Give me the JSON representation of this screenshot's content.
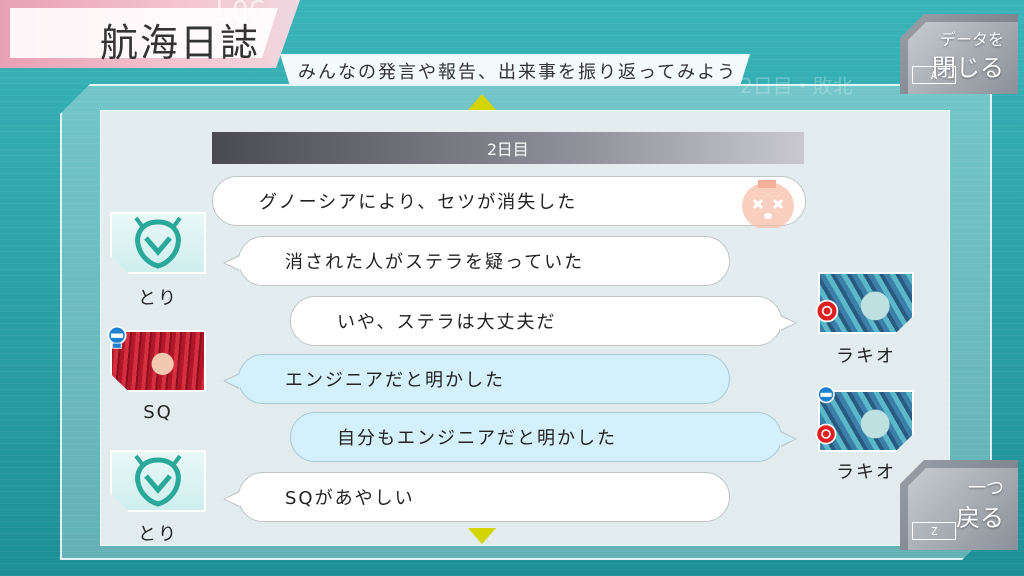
{
  "header": {
    "title": "航海日誌",
    "log_label": "LOG",
    "subtitle": "みんなの発言や報告、出来事を振り返ってみよう"
  },
  "buttons": {
    "close": {
      "line1": "データを",
      "line2": "閉じる",
      "key": "A"
    },
    "back": {
      "line1": "一つ",
      "line2": "戻る",
      "key": "Z"
    }
  },
  "day": {
    "label": "2日目"
  },
  "entries": [
    {
      "type": "event",
      "text": "グノーシアにより、セツが消失した"
    },
    {
      "speaker": "とり",
      "text": "消された人がステラを疑っていた",
      "side": "left"
    },
    {
      "speaker": "ラキオ",
      "text": "いや、ステラは大丈夫だ",
      "side": "right"
    },
    {
      "speaker": "SQ",
      "text": "エンジニアだと明かした",
      "side": "left"
    },
    {
      "speaker": "ラキオ",
      "text": "自分もエンジニアだと明かした",
      "side": "right"
    },
    {
      "speaker": "とり",
      "text": "SQがあやしい",
      "side": "left"
    }
  ],
  "background": {
    "ghost_right": "2日目・敗北"
  },
  "colors": {
    "teal_bg": "#2aa3a8",
    "accent_pink": "#e8a0b4",
    "arrow_yellow": "#d4d400",
    "bubble_blue": "#d4f0fa"
  },
  "icons": [
    "scroll-up-icon",
    "scroll-down-icon",
    "engineer-role-icon",
    "gnosia-target-icon",
    "vanished-face-icon"
  ]
}
